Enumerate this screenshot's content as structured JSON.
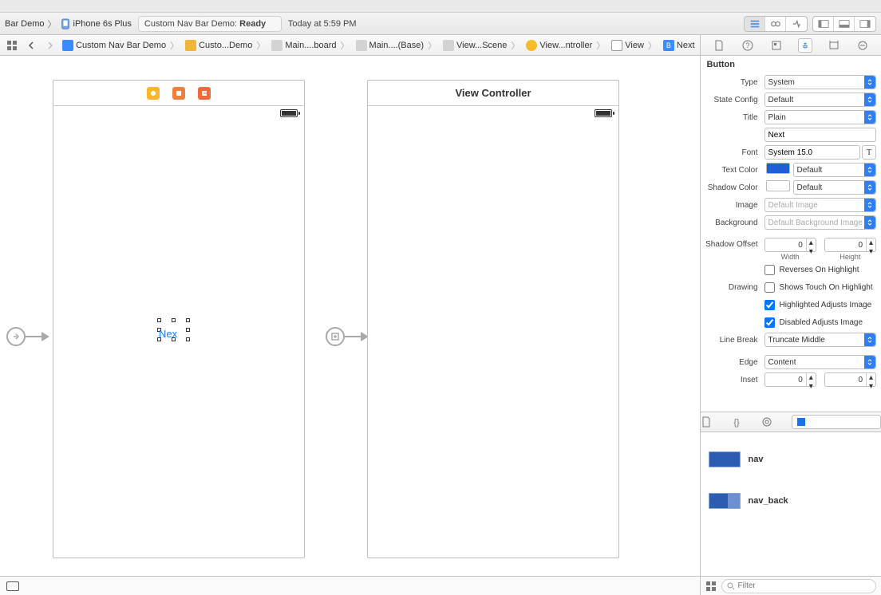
{
  "window": {
    "project": "Bar Demo",
    "device": "iPhone 6s Plus"
  },
  "status": {
    "label": "Custom Nav Bar Demo:",
    "state": "Ready",
    "time": "Today at 5:59 PM"
  },
  "breadcrumb": {
    "project": "Custom Nav Bar Demo",
    "folder": "Custo...Demo",
    "storyboard": "Main....board",
    "base": "Main....(Base)",
    "scene": "View...Scene",
    "controller": "View...ntroller",
    "view": "View",
    "button": "Next"
  },
  "canvas": {
    "left_scene": {
      "selected_text": "Nex"
    },
    "right_scene": {
      "title": "View Controller"
    }
  },
  "inspector": {
    "header": "Button",
    "button": {
      "type": "System",
      "state_config": "Default",
      "title_mode": "Plain",
      "title_text": "Next",
      "font": "System 15.0",
      "text_color_label": "Default",
      "shadow_color_label": "Default",
      "image_placeholder": "Default Image",
      "background_placeholder": "Default Background Image",
      "shadow_offset": {
        "width": 0,
        "height": 0
      },
      "drawing": {
        "reverses_on_highlight": false,
        "shows_touch_on_highlight": false,
        "highlighted_adjusts_image": true,
        "disabled_adjusts_image": true,
        "labels": {
          "reverses": "Reverses On Highlight",
          "shows_touch": "Shows Touch On Highlight",
          "highlighted": "Highlighted Adjusts Image",
          "disabled": "Disabled Adjusts Image"
        }
      },
      "line_break": "Truncate Middle",
      "edge": "Content",
      "inset": {
        "a": 0,
        "b": 0
      }
    },
    "labels": {
      "type": "Type",
      "state": "State Config",
      "title": "Title",
      "font": "Font",
      "text_color": "Text Color",
      "shadow_color": "Shadow Color",
      "image": "Image",
      "background": "Background",
      "shadow_offset": "Shadow Offset",
      "drawing": "Drawing",
      "line_break": "Line Break",
      "edge": "Edge",
      "inset": "Inset",
      "width": "Width",
      "height": "Height"
    }
  },
  "library": {
    "items": [
      {
        "name": "nav"
      },
      {
        "name": "nav_back"
      }
    ],
    "filter_placeholder": "Filter"
  }
}
